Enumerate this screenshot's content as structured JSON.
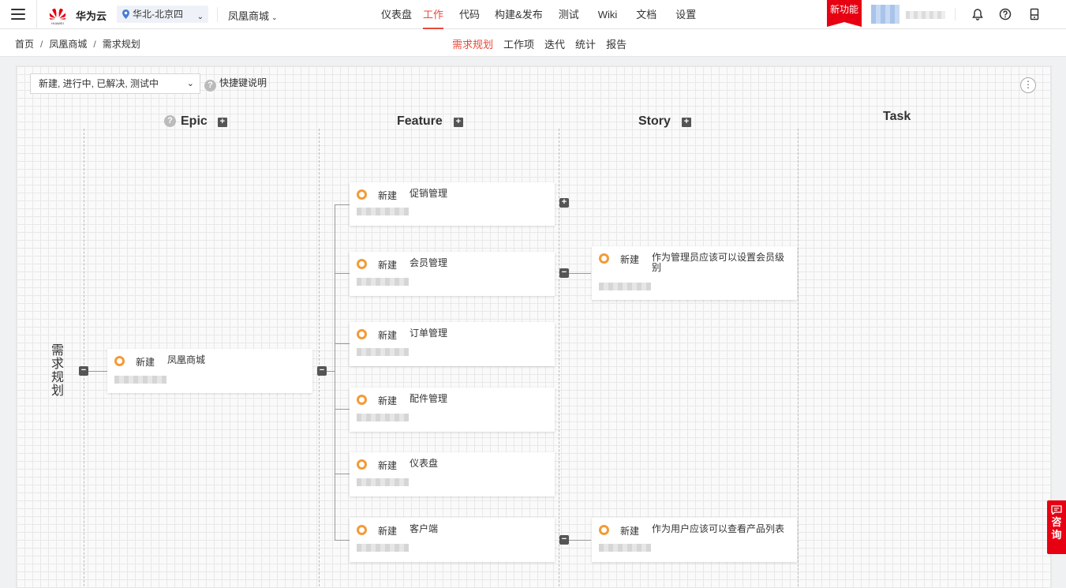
{
  "brand": {
    "name": "华为云",
    "logo_sub": "HUAWEI"
  },
  "region": {
    "label": "华北-北京四"
  },
  "project": {
    "label": "凤凰商城"
  },
  "main_nav": [
    {
      "label": "仪表盘",
      "active": false
    },
    {
      "label": "工作",
      "active": true
    },
    {
      "label": "代码",
      "active": false
    },
    {
      "label": "构建&发布",
      "active": false
    },
    {
      "label": "测试",
      "active": false
    },
    {
      "label": "Wiki",
      "active": false
    },
    {
      "label": "文档",
      "active": false
    },
    {
      "label": "设置",
      "active": false
    }
  ],
  "new_feature": "新功能",
  "breadcrumb": [
    "首页",
    "凤凰商城",
    "需求规划"
  ],
  "sub_nav": [
    {
      "label": "需求规划",
      "active": true
    },
    {
      "label": "工作项",
      "active": false
    },
    {
      "label": "迭代",
      "active": false
    },
    {
      "label": "统计",
      "active": false
    },
    {
      "label": "报告",
      "active": false
    }
  ],
  "board": {
    "filter": "新建, 进行中, 已解决, 测试中",
    "shortcut": "快捷键说明",
    "columns": {
      "epic": "Epic",
      "feature": "Feature",
      "story": "Story",
      "task": "Task"
    },
    "root_label": "需求规划",
    "epic": {
      "status": "新建",
      "title": "凤凰商城"
    },
    "features": [
      {
        "status": "新建",
        "title": "促销管理"
      },
      {
        "status": "新建",
        "title": "会员管理"
      },
      {
        "status": "新建",
        "title": "订单管理"
      },
      {
        "status": "新建",
        "title": "配件管理"
      },
      {
        "status": "新建",
        "title": "仪表盘"
      },
      {
        "status": "新建",
        "title": "客户端"
      }
    ],
    "stories": [
      {
        "status": "新建",
        "title": "作为管理员应该可以设置会员级别"
      },
      {
        "status": "新建",
        "title": "作为用户应该可以查看产品列表"
      }
    ]
  },
  "consult": [
    "咨",
    "询"
  ],
  "colors": {
    "accent": "#e84a3b",
    "brand_red": "#e60012",
    "status_new": "#f29b38"
  }
}
